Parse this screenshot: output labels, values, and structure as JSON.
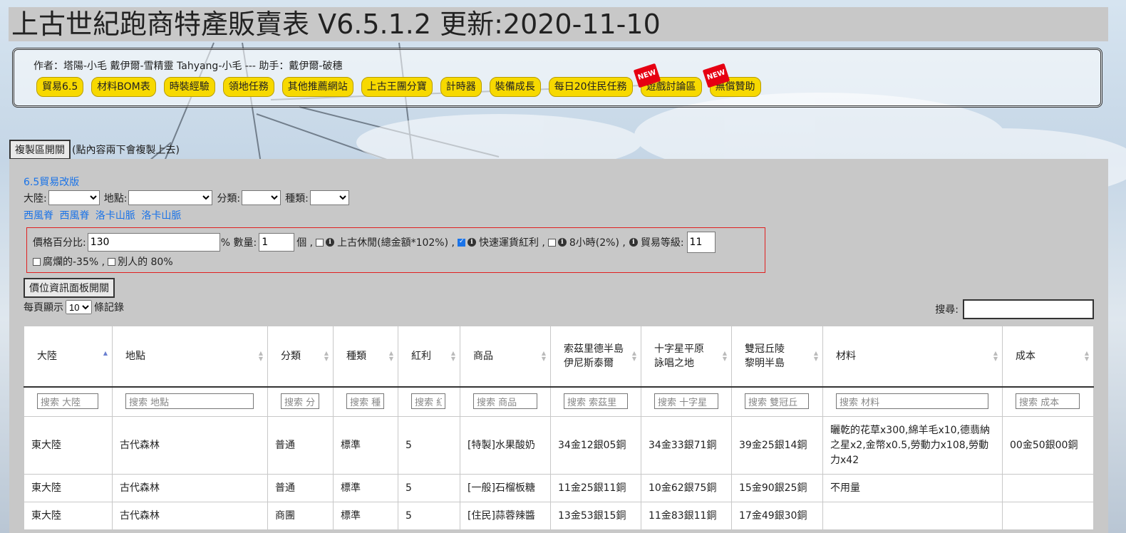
{
  "title": "上古世紀跑商特產販賣表 V6.5.1.2 更新:2020-11-10",
  "authors": "作者：塔陽-小毛 戴伊爾-雪精靈 Tahyang-小毛 --- 助手：戴伊爾-破穗",
  "nav": [
    {
      "label": "貿易6.5",
      "new": false
    },
    {
      "label": "材料BOM表",
      "new": false
    },
    {
      "label": "時裝經驗",
      "new": false
    },
    {
      "label": "領地任務",
      "new": false
    },
    {
      "label": "其他推薦網站",
      "new": false
    },
    {
      "label": "上古王團分寶",
      "new": false
    },
    {
      "label": "計時器",
      "new": false
    },
    {
      "label": "裝備成長",
      "new": false
    },
    {
      "label": "每日20住民任務",
      "new": false
    },
    {
      "label": "遊戲討論區",
      "new": true
    },
    {
      "label": "無償贊助",
      "new": true
    }
  ],
  "new_badge": "NEW",
  "copy": {
    "button": "複製區開關",
    "hint": "(點內容兩下會複製上去)"
  },
  "version_link": "6.5貿易改版",
  "filters": {
    "continent": "大陸:",
    "location": "地點:",
    "category": "分類:",
    "type": "種類:"
  },
  "regions": [
    "西風脊",
    "西風脊",
    "洛卡山脈",
    "洛卡山脈"
  ],
  "settings": {
    "price_pct_label": "價格百分比:",
    "price_pct": "130",
    "qty_label": "% 數量:",
    "qty": "1",
    "unit": "個 ,",
    "leisure": "上古休閒(總金額*102%) ,",
    "fast": "快速運貨紅利 ,",
    "eight": "8小時(2%) ,",
    "trade_level_label": "貿易等級:",
    "trade_level": "11",
    "rotten": "腐爛的-35% ,",
    "others": "別人的 80%",
    "leisure_checked": false,
    "fast_checked": true,
    "eight_checked": false,
    "rotten_checked": false,
    "others_checked": false
  },
  "price_panel_button": "價位資訊面板開關",
  "page_size": {
    "prefix": "每頁顯示",
    "value": "10",
    "suffix": "條記錄"
  },
  "search_label": "搜尋:",
  "table": {
    "headers": [
      "大陸",
      "地點",
      "分類",
      "種類",
      "紅利",
      "商品",
      "索茲里德半島\n伊尼斯泰爾",
      "十字星平原\n詠唱之地",
      "雙冠丘陵\n黎明半島",
      "材料",
      "成本"
    ],
    "filters": [
      "搜索 大陸",
      "搜索 地點",
      "搜索 分",
      "搜索 種",
      "搜索 紅",
      "搜索 商品",
      "搜索 索茲里",
      "搜索 十字星",
      "搜索 雙冠丘",
      "搜索 材料",
      "搜索 成本"
    ],
    "rows": [
      [
        "東大陸",
        "古代森林",
        "普通",
        "標準",
        "5",
        "[特製]水果酸奶",
        "34金12銀05銅",
        "34金33銀71銅",
        "39金25銀14銅",
        "曬乾的花草x300,綿羊毛x10,德翡納之星x2,金幣x0.5,勞動力x108,勞動力x42",
        "00金50銀00銅"
      ],
      [
        "東大陸",
        "古代森林",
        "普通",
        "標準",
        "5",
        "[一般]石榴板糖",
        "11金25銀11銅",
        "10金62銀75銅",
        "15金90銀25銅",
        "不用量",
        ""
      ],
      [
        "東大陸",
        "古代森林",
        "商團",
        "標準",
        "5",
        "[住民]蒜蓉辣醬",
        "13金53銀15銅",
        "11金83銀11銅",
        "17金49銀30銅",
        "",
        ""
      ]
    ]
  },
  "colors": {
    "nav_button": "#f7d900",
    "link": "#1a73e8",
    "panel": "#c8c8c8",
    "settings_border": "#e02020"
  }
}
